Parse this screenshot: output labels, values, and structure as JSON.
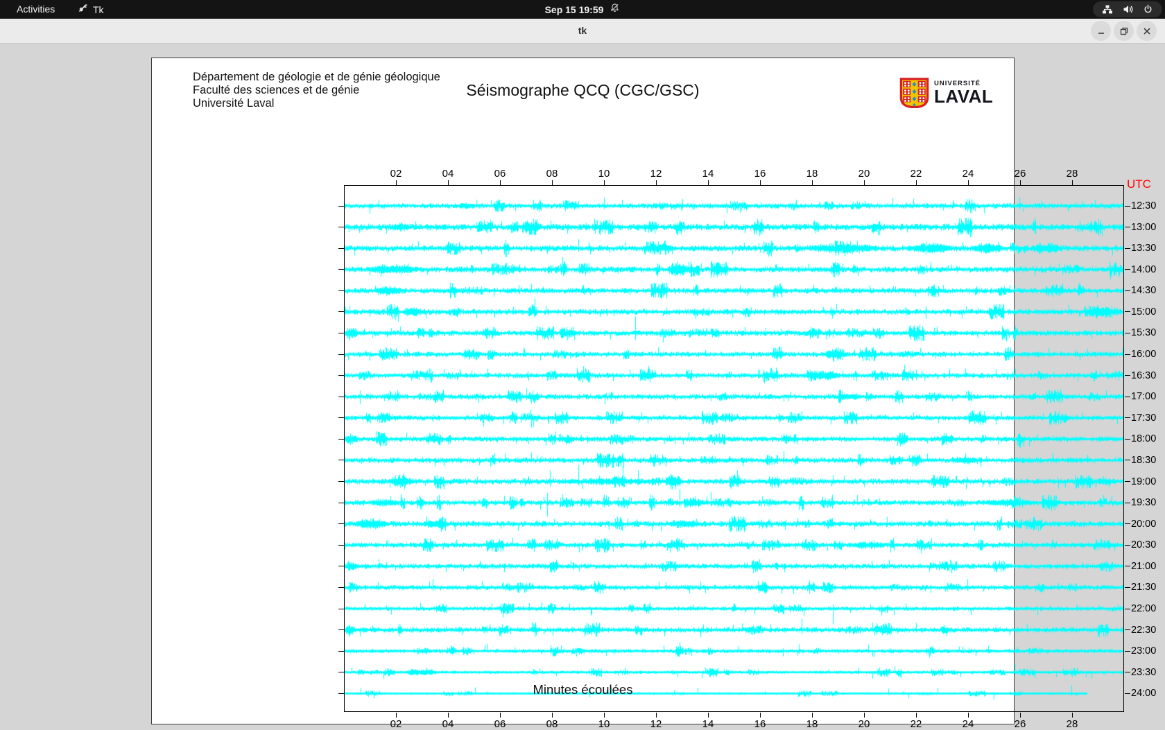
{
  "top_bar": {
    "activities_label": "Activities",
    "app_name": "Tk",
    "clock": "Sep 15 19:59",
    "tray_icons": [
      "network-icon",
      "volume-icon",
      "power-icon"
    ],
    "notification_icon": "bell-muted-icon"
  },
  "window": {
    "title": "tk",
    "controls": [
      "minimize",
      "maximize",
      "close"
    ]
  },
  "header": {
    "org_lines": [
      "Département de géologie et de génie géologique",
      "Faculté des sciences et de génie",
      "Université Laval"
    ],
    "title": "Séismographe QCQ (CGC/GSC)",
    "logo": {
      "line1": "UNIVERSITÉ",
      "line2": "LAVAL"
    }
  },
  "chart_data": {
    "type": "line",
    "title": "Séismographe QCQ (CGC/GSC)",
    "xlabel": "Minutes écoulées",
    "right_axis_label": "UTC",
    "right_axis_label_color": "#ff0000",
    "trace_color": "#00ffff",
    "x_range_minutes": [
      0,
      30
    ],
    "x_ticks": [
      "02",
      "04",
      "06",
      "08",
      "10",
      "12",
      "14",
      "16",
      "18",
      "20",
      "22",
      "24",
      "26",
      "28"
    ],
    "row_labels": [
      "12:30",
      "13:00",
      "13:30",
      "14:00",
      "14:30",
      "15:00",
      "15:30",
      "16:00",
      "16:30",
      "17:00",
      "17:30",
      "18:00",
      "18:30",
      "19:00",
      "19:30",
      "20:00",
      "20:30",
      "21:00",
      "21:30",
      "22:00",
      "22:30",
      "23:00",
      "23:30",
      "24:00"
    ],
    "rows": [
      {
        "label": "12:30",
        "seed": 101,
        "amp": 3.0,
        "end": 30,
        "bursts": [
          [
            4.3,
            4.9,
            6
          ]
        ],
        "spikes": [
          [
            1.3,
            9,
            4
          ],
          [
            5.9,
            8,
            3
          ],
          [
            10.0,
            12,
            5
          ],
          [
            13.0,
            10,
            4
          ],
          [
            18.3,
            6,
            3
          ],
          [
            21.1,
            11,
            4
          ],
          [
            26.0,
            12,
            5
          ],
          [
            28.9,
            9,
            3
          ]
        ]
      },
      {
        "label": "13:00",
        "seed": 108,
        "amp": 3.8,
        "end": 30,
        "bursts": [
          [
            1.6,
            2.6,
            7
          ]
        ],
        "spikes": [
          [
            5.6,
            11,
            4
          ],
          [
            9.3,
            6,
            3
          ],
          [
            14.6,
            9,
            4
          ],
          [
            18.1,
            7,
            3
          ],
          [
            23.5,
            6,
            3
          ]
        ]
      },
      {
        "label": "13:30",
        "seed": 115,
        "amp": 3.4,
        "end": 30,
        "bursts": [
          [
            17.7,
            20.7,
            9
          ],
          [
            21.6,
            23.4,
            10
          ],
          [
            24.1,
            25.4,
            10
          ],
          [
            26.4,
            27.7,
            10
          ]
        ],
        "spikes": [
          [
            2.6,
            7,
            3
          ],
          [
            9.0,
            13,
            5
          ],
          [
            10.8,
            9,
            4
          ],
          [
            15.4,
            8,
            3
          ]
        ]
      },
      {
        "label": "14:00",
        "seed": 122,
        "amp": 3.4,
        "end": 30,
        "bursts": [
          [
            0.8,
            2.9,
            9
          ],
          [
            12.4,
            13.3,
            12
          ]
        ],
        "spikes": [
          [
            6.2,
            10,
            4
          ],
          [
            16.6,
            7,
            3
          ],
          [
            19.6,
            8,
            3
          ],
          [
            22.4,
            6,
            3
          ],
          [
            27.2,
            6,
            3
          ]
        ]
      },
      {
        "label": "14:30",
        "seed": 129,
        "amp": 3.2,
        "end": 30,
        "bursts": [
          [
            1.1,
            2.2,
            9
          ]
        ],
        "spikes": [
          [
            6.7,
            8,
            3
          ],
          [
            13.6,
            6,
            3
          ],
          [
            18.9,
            6,
            3
          ],
          [
            21.2,
            6,
            3
          ],
          [
            25.8,
            7,
            3
          ]
        ]
      },
      {
        "label": "15:00",
        "seed": 136,
        "amp": 3.2,
        "end": 30,
        "bursts": [
          [
            2.2,
            3.0,
            9
          ],
          [
            28.5,
            30,
            11
          ]
        ],
        "spikes": [
          [
            0.2,
            8,
            3
          ],
          [
            6.5,
            7,
            3
          ],
          [
            12.4,
            6,
            3
          ],
          [
            24.4,
            6,
            3
          ],
          [
            27.9,
            10,
            4
          ]
        ]
      },
      {
        "label": "15:30",
        "seed": 143,
        "amp": 3.2,
        "end": 30,
        "bursts": [
          [
            0,
            0.5,
            12
          ]
        ],
        "spikes": [
          [
            1.8,
            7,
            3
          ],
          [
            11.2,
            24,
            10
          ],
          [
            16.8,
            6,
            3
          ],
          [
            22.7,
            8,
            3
          ],
          [
            25.9,
            6,
            3
          ]
        ]
      },
      {
        "label": "16:00",
        "seed": 150,
        "amp": 3.0,
        "end": 30,
        "bursts": [
          [
            18.4,
            19.4,
            8
          ]
        ],
        "spikes": [
          [
            2.3,
            5,
            3
          ],
          [
            6.9,
            10,
            4
          ],
          [
            13.9,
            6,
            3
          ],
          [
            24.2,
            5,
            3
          ],
          [
            28.6,
            8,
            3
          ]
        ]
      },
      {
        "label": "16:30",
        "seed": 157,
        "amp": 3.0,
        "end": 30,
        "bursts": [
          [
            17.8,
            19.2,
            8
          ]
        ],
        "spikes": [
          [
            4.9,
            7,
            3
          ],
          [
            11.7,
            14,
            6
          ],
          [
            23.3,
            10,
            4
          ],
          [
            27.3,
            5,
            3
          ],
          [
            29.1,
            7,
            3
          ]
        ]
      },
      {
        "label": "17:00",
        "seed": 164,
        "amp": 3.0,
        "end": 30,
        "bursts": [
          [
            19.1,
            19.9,
            7
          ]
        ],
        "spikes": [
          [
            7.0,
            12,
            5
          ],
          [
            14.3,
            6,
            3
          ],
          [
            21.3,
            8,
            3
          ],
          [
            26.6,
            6,
            3
          ]
        ]
      },
      {
        "label": "17:30",
        "seed": 171,
        "amp": 2.9,
        "end": 30,
        "bursts": [],
        "spikes": [
          [
            3.4,
            5,
            3
          ],
          [
            6.9,
            7,
            3
          ],
          [
            12.3,
            5,
            3
          ],
          [
            17.6,
            10,
            4
          ],
          [
            21.9,
            8,
            3
          ],
          [
            25.0,
            6,
            3
          ],
          [
            26.9,
            7,
            3
          ]
        ]
      },
      {
        "label": "18:00",
        "seed": 178,
        "amp": 3.0,
        "end": 30,
        "bursts": [
          [
            0,
            0.5,
            10
          ]
        ],
        "spikes": [
          [
            3.3,
            8,
            3
          ],
          [
            9.1,
            6,
            3
          ],
          [
            12.5,
            5,
            3
          ],
          [
            16.9,
            8,
            4
          ],
          [
            21.4,
            6,
            3
          ],
          [
            24.6,
            6,
            3
          ],
          [
            26.7,
            7,
            3
          ]
        ]
      },
      {
        "label": "18:30",
        "seed": 185,
        "amp": 3.1,
        "end": 30,
        "bursts": [
          [
            23.4,
            24.4,
            7
          ]
        ],
        "spikes": [
          [
            3.0,
            5,
            3
          ],
          [
            7.6,
            6,
            3
          ],
          [
            12.9,
            6,
            3
          ],
          [
            16.9,
            13,
            5
          ],
          [
            20.3,
            5,
            3
          ],
          [
            23.9,
            10,
            4
          ]
        ]
      },
      {
        "label": "19:00",
        "seed": 192,
        "amp": 3.2,
        "end": 30,
        "bursts": [
          [
            1.6,
            2.7,
            8
          ],
          [
            8.1,
            12.2,
            6
          ],
          [
            12.3,
            13.0,
            13
          ]
        ],
        "spikes": [
          [
            5.1,
            7,
            3
          ],
          [
            7.9,
            16,
            8
          ],
          [
            9.0,
            24,
            6
          ],
          [
            10.7,
            22,
            6
          ],
          [
            11.3,
            16,
            5
          ],
          [
            18.8,
            9,
            4
          ],
          [
            25.4,
            6,
            3
          ]
        ]
      },
      {
        "label": "19:30",
        "seed": 199,
        "amp": 3.1,
        "end": 30,
        "bursts": [
          [
            1.0,
            2.1,
            7
          ],
          [
            13.0,
            13.9,
            8
          ],
          [
            24.4,
            26.6,
            7
          ]
        ],
        "spikes": [
          [
            7.8,
            14,
            20
          ],
          [
            8.4,
            12,
            5
          ],
          [
            12.9,
            20,
            6
          ],
          [
            13.5,
            9,
            4
          ],
          [
            14.1,
            15,
            5
          ],
          [
            20.6,
            6,
            3
          ]
        ]
      },
      {
        "label": "20:00",
        "seed": 206,
        "amp": 3.3,
        "end": 30,
        "bursts": [
          [
            0.4,
            1.7,
            10
          ],
          [
            3.0,
            3.7,
            8
          ],
          [
            12.4,
            13.7,
            8
          ]
        ],
        "spikes": [
          [
            7.4,
            6,
            3
          ],
          [
            17.0,
            6,
            3
          ],
          [
            20.9,
            10,
            4
          ],
          [
            23.2,
            8,
            4
          ],
          [
            28.1,
            6,
            3
          ]
        ]
      },
      {
        "label": "20:30",
        "seed": 213,
        "amp": 3.0,
        "end": 30,
        "bursts": [
          [
            19.4,
            20.9,
            7
          ]
        ],
        "spikes": [
          [
            4.3,
            8,
            3
          ],
          [
            9.6,
            5,
            3
          ],
          [
            14.8,
            5,
            3
          ],
          [
            22.6,
            10,
            4
          ],
          [
            26.1,
            6,
            3
          ]
        ]
      },
      {
        "label": "21:00",
        "seed": 220,
        "amp": 3.0,
        "end": 30,
        "bursts": [
          [
            0,
            0.5,
            10
          ]
        ],
        "spikes": [
          [
            1.3,
            10,
            4
          ],
          [
            5.2,
            8,
            3
          ],
          [
            8.7,
            8,
            3
          ],
          [
            11.6,
            6,
            3
          ],
          [
            15.4,
            5,
            3
          ],
          [
            20.3,
            8,
            4
          ],
          [
            24.8,
            5,
            3
          ],
          [
            28.4,
            6,
            3
          ]
        ]
      },
      {
        "label": "21:30",
        "seed": 227,
        "amp": 2.8,
        "end": 30,
        "bursts": [],
        "spikes": [
          [
            3.4,
            12,
            5
          ],
          [
            6.1,
            8,
            3
          ],
          [
            9.9,
            5,
            3
          ],
          [
            12.1,
            8,
            3
          ],
          [
            13.7,
            8,
            3
          ],
          [
            17.9,
            10,
            4
          ],
          [
            21.3,
            5,
            3
          ],
          [
            24.0,
            12,
            5
          ],
          [
            27.5,
            6,
            3
          ]
        ]
      },
      {
        "label": "22:00",
        "seed": 234,
        "amp": 2.4,
        "end": 30,
        "bursts": [],
        "spikes": [
          [
            2.1,
            4,
            2
          ],
          [
            7.1,
            8,
            3
          ],
          [
            13.3,
            4,
            2
          ],
          [
            18.8,
            6,
            22
          ],
          [
            21.6,
            8,
            3
          ],
          [
            25.2,
            4,
            2
          ],
          [
            28.2,
            6,
            3
          ]
        ]
      },
      {
        "label": "22:30",
        "seed": 241,
        "amp": 3.0,
        "end": 30,
        "bursts": [
          [
            0,
            0.4,
            10
          ]
        ],
        "spikes": [
          [
            4.4,
            5,
            3
          ],
          [
            9.8,
            10,
            4
          ],
          [
            13.8,
            8,
            3
          ],
          [
            16.4,
            8,
            3
          ],
          [
            17.6,
            16,
            6
          ],
          [
            22.0,
            10,
            4
          ],
          [
            26.3,
            8,
            3
          ]
        ]
      },
      {
        "label": "23:00",
        "seed": 248,
        "amp": 2.3,
        "end": 30,
        "bursts": [],
        "spikes": [
          [
            4.1,
            8,
            3
          ],
          [
            8.8,
            4,
            2
          ],
          [
            12.3,
            8,
            3
          ],
          [
            17.5,
            10,
            4
          ],
          [
            21.0,
            4,
            2
          ],
          [
            24.8,
            8,
            3
          ],
          [
            25.9,
            6,
            3
          ]
        ]
      },
      {
        "label": "23:30",
        "seed": 255,
        "amp": 1.9,
        "end": 30,
        "bursts": [
          [
            2.2,
            3.7,
            5
          ]
        ],
        "spikes": [
          [
            9.4,
            4,
            2
          ],
          [
            14.2,
            4,
            2
          ],
          [
            19.8,
            7,
            3
          ],
          [
            25.8,
            12,
            4
          ]
        ]
      },
      {
        "label": "24:00",
        "seed": 262,
        "amp": 1.4,
        "end": 28.6,
        "bursts": [],
        "spikes": [
          [
            5.5,
            3,
            2
          ],
          [
            11.0,
            3,
            2
          ],
          [
            16.2,
            3,
            2
          ],
          [
            21.5,
            3,
            2
          ],
          [
            28.0,
            12,
            3
          ]
        ]
      }
    ]
  }
}
